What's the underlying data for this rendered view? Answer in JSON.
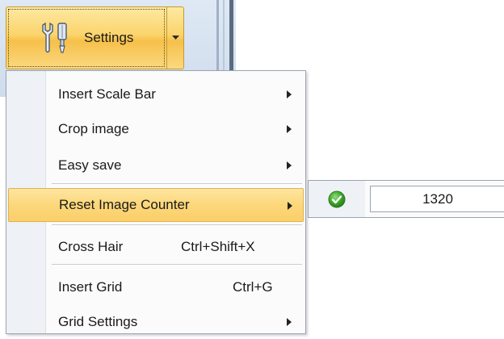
{
  "toolbar": {
    "settings_label": "Settings"
  },
  "menu": {
    "items": [
      {
        "label": "Insert Scale Bar",
        "shortcut": "",
        "submenu": true
      },
      {
        "label": "Crop image",
        "shortcut": "",
        "submenu": true
      },
      {
        "label": "Easy save",
        "shortcut": "",
        "submenu": true
      },
      {
        "label": "Reset Image Counter",
        "shortcut": "",
        "submenu": true,
        "highlighted": true
      },
      {
        "label": "Cross Hair",
        "shortcut": "Ctrl+Shift+X",
        "submenu": false
      },
      {
        "label": "Insert Grid",
        "shortcut": "Ctrl+G",
        "submenu": false
      },
      {
        "label": "Grid Settings",
        "shortcut": "",
        "submenu": true
      }
    ]
  },
  "submenu": {
    "counter_value": "1320",
    "confirm_icon": "green-check-icon"
  },
  "colors": {
    "highlight": "#fbd46c",
    "check_green": "#3fa52c"
  }
}
